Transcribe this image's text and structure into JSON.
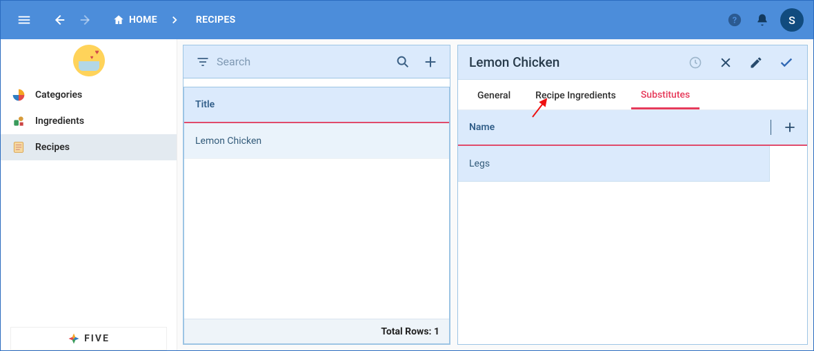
{
  "header": {
    "breadcrumbs": [
      {
        "label": "HOME"
      },
      {
        "label": "RECIPES"
      }
    ],
    "avatar_initial": "S"
  },
  "sidebar": {
    "items": [
      {
        "label": "Categories",
        "name": "sidebar-item-categories",
        "icon": "pie-icon",
        "selected": false
      },
      {
        "label": "Ingredients",
        "name": "sidebar-item-ingredients",
        "icon": "ingredients-icon",
        "selected": false
      },
      {
        "label": "Recipes",
        "name": "sidebar-item-recipes",
        "icon": "recipe-icon",
        "selected": true
      }
    ],
    "footer_brand": "FIVE"
  },
  "list_panel": {
    "search_placeholder": "Search",
    "column_header": "Title",
    "rows": [
      {
        "title": "Lemon Chicken",
        "selected": true
      }
    ],
    "footer_label": "Total Rows:",
    "footer_count": "1"
  },
  "detail_panel": {
    "title": "Lemon Chicken",
    "tabs": [
      {
        "label": "General",
        "name": "tab-general",
        "active": false
      },
      {
        "label": "Recipe Ingredients",
        "name": "tab-recipe-ingredients",
        "active": false
      },
      {
        "label": "Substitutes",
        "name": "tab-substitutes",
        "active": true
      }
    ],
    "sub_header": "Name",
    "sub_rows": [
      {
        "name": "Legs"
      }
    ]
  }
}
